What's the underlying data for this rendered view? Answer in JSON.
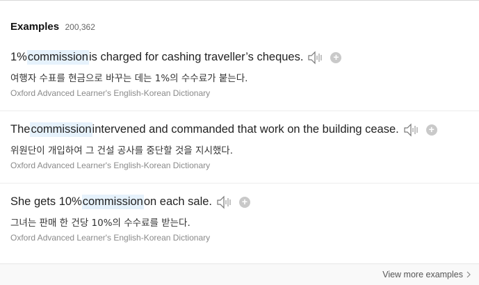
{
  "header": {
    "title": "Examples",
    "count": "200,362"
  },
  "examples": [
    {
      "before": "1% ",
      "keyword": "commission",
      "after": " is charged for cashing traveller’s cheques.",
      "korean": "여행자 수표를 현금으로 바꾸는 데는 1%의 수수료가 붙는다.",
      "source": "Oxford Advanced Learner's English-Korean Dictionary"
    },
    {
      "before": "The ",
      "keyword": "commission",
      "after": " intervened and commanded that work on the building cease.",
      "korean": "위원단이 개입하여 그 건설 공사를 중단할 것을 지시했다.",
      "source": "Oxford Advanced Learner's English-Korean Dictionary"
    },
    {
      "before": "She gets 10% ",
      "keyword": "commission",
      "after": " on each sale.",
      "korean": "그녀는 판매 한 건당 10%의 수수료를 받는다.",
      "source": "Oxford Advanced Learner's English-Korean Dictionary"
    }
  ],
  "footer": {
    "more_label": "View more examples"
  },
  "icons": {
    "speaker": "speaker-icon",
    "add": "plus-circle-icon",
    "chevron": "chevron-right-icon"
  },
  "colors": {
    "highlight": "#e6f2fc",
    "add_button": "#c9c9c9"
  }
}
